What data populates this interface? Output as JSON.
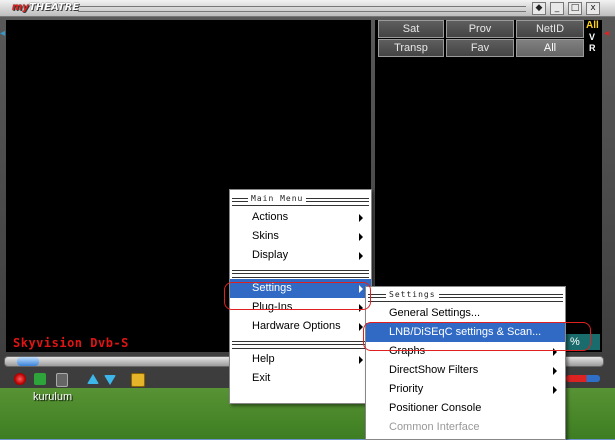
{
  "window": {
    "logo_prefix": "my",
    "logo_main": "THEATRE",
    "title_buttons": [
      "◆",
      "_",
      "□",
      "x"
    ]
  },
  "filter_buttons": {
    "row1": [
      {
        "label": "Sat"
      },
      {
        "label": "Prov"
      },
      {
        "label": "NetID"
      }
    ],
    "row2": [
      {
        "label": "Transp"
      },
      {
        "label": "Fav"
      },
      {
        "label": "All",
        "selected": true
      }
    ]
  },
  "side_toggles": {
    "all": "All",
    "v": "V",
    "r": "R"
  },
  "channel_label": "Skyvision Dvb-S",
  "status_percent": "%",
  "seek": {
    "position": 0.02
  },
  "volume": {
    "level": 0.6
  },
  "desktop_icon_label": "kurulum",
  "main_menu": {
    "header": "Main Menu",
    "group1": [
      {
        "label": "Actions",
        "submenu": true
      },
      {
        "label": "Skins",
        "submenu": true
      },
      {
        "label": "Display",
        "submenu": true
      }
    ],
    "group2": [
      {
        "label": "Settings",
        "submenu": true,
        "highlighted": true
      },
      {
        "label": "Plug-Ins",
        "submenu": true
      },
      {
        "label": "Hardware Options",
        "submenu": true
      }
    ],
    "group3": [
      {
        "label": "Help",
        "submenu": true
      },
      {
        "label": "Exit",
        "submenu": false
      }
    ]
  },
  "settings_menu": {
    "header": "Settings",
    "items": [
      {
        "label": "General Settings...",
        "submenu": false
      },
      {
        "label": "LNB/DiSEqC settings & Scan...",
        "submenu": false,
        "highlighted": true
      },
      {
        "label": "Graphs",
        "submenu": true
      },
      {
        "label": "DirectShow Filters",
        "submenu": true
      },
      {
        "label": "Priority",
        "submenu": true
      },
      {
        "label": "Positioner Console",
        "submenu": false
      },
      {
        "label": "Common Interface",
        "submenu": false,
        "disabled": true
      }
    ]
  },
  "colors": {
    "highlight": "#316ac5",
    "channel_text": "#e01414",
    "annotation_ring": "#e02020"
  }
}
